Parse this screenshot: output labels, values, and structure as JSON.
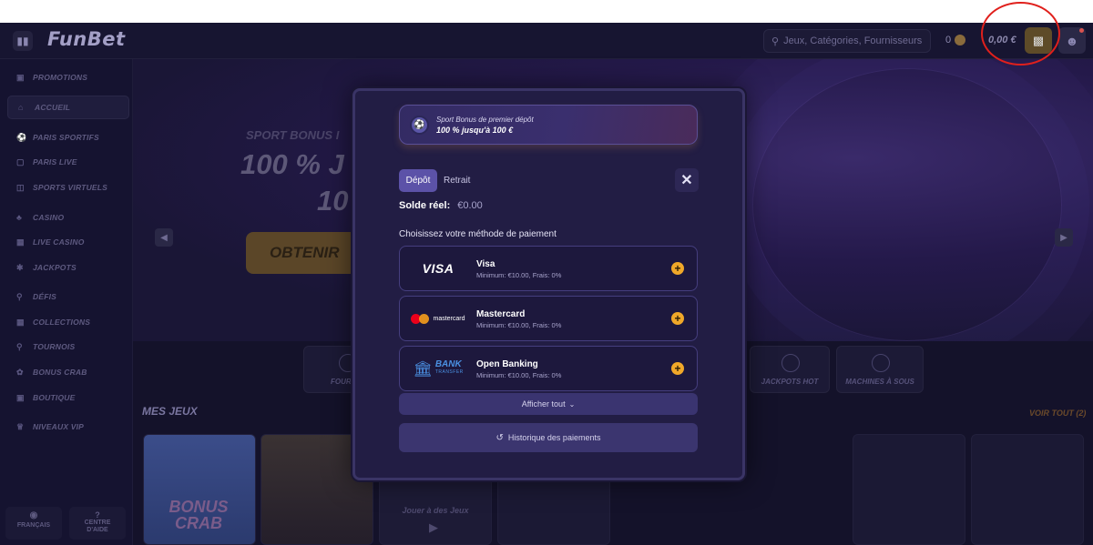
{
  "header": {
    "logo": "FunBet",
    "search_placeholder": "Jeux, Catégories, Fournisseurs",
    "coins": "0",
    "balance": "0,00 €"
  },
  "sidebar": {
    "items": [
      {
        "label": "PROMOTIONS",
        "icon": "gift-icon"
      },
      {
        "label": "ACCUEIL",
        "icon": "home-icon"
      },
      {
        "label": "PARIS SPORTIFS",
        "icon": "ball-icon"
      },
      {
        "label": "PARIS LIVE",
        "icon": "live-icon"
      },
      {
        "label": "SPORTS VIRTUELS",
        "icon": "gamepad-icon"
      },
      {
        "label": "CASINO",
        "icon": "cards-icon"
      },
      {
        "label": "LIVE CASINO",
        "icon": "dealer-icon"
      },
      {
        "label": "JACKPOTS",
        "icon": "jackpot-icon"
      },
      {
        "label": "DÉFIS",
        "icon": "target-icon"
      },
      {
        "label": "COLLECTIONS",
        "icon": "collection-icon"
      },
      {
        "label": "TOURNOIS",
        "icon": "trophy-icon"
      },
      {
        "label": "BONUS CRAB",
        "icon": "crab-icon"
      },
      {
        "label": "BOUTIQUE",
        "icon": "shop-icon"
      },
      {
        "label": "NIVEAUX VIP",
        "icon": "crown-icon"
      }
    ],
    "footer": {
      "language": "FRANÇAIS",
      "help": "CENTRE D'AIDE"
    }
  },
  "banner": {
    "subtitle": "SPORT BONUS I",
    "line1": "100 % J",
    "line2": "10",
    "button": "OBTENIR"
  },
  "categories": [
    {
      "label": "FOURNIS"
    },
    {
      "label": "JACKPOTS HOT"
    },
    {
      "label": "MACHINES À SOUS"
    }
  ],
  "games": {
    "section_title": "MES JEUX",
    "see_all": "VOIR TOUT (2)",
    "card1_text": "BONUS CRAB",
    "card3_text": "Jouer à des Jeux"
  },
  "modal": {
    "promo": {
      "line1": "Sport Bonus de premier dépôt",
      "line2": "100 % jusqu'à 100 €"
    },
    "tabs": {
      "deposit": "Dépôt",
      "withdraw": "Retrait"
    },
    "balance_label": "Solde réel:",
    "balance_value": "€0.00",
    "choose_label": "Choisissez votre méthode de paiement",
    "methods": [
      {
        "name": "Visa",
        "desc": "Minimum: €10.00, Frais: 0%",
        "logo": "VISA"
      },
      {
        "name": "Mastercard",
        "desc": "Minimum: €10.00, Frais: 0%",
        "logo": "mastercard"
      },
      {
        "name": "Open Banking",
        "desc": "Minimum: €10.00, Frais: 0%",
        "logo": "BANK",
        "logo_sub": "TRANSFER"
      }
    ],
    "show_all": "Afficher tout",
    "history": "Historique des paiements"
  },
  "colors": {
    "accent": "#5c52a8",
    "plus": "#f0a829",
    "annotation": "#e0201c"
  }
}
